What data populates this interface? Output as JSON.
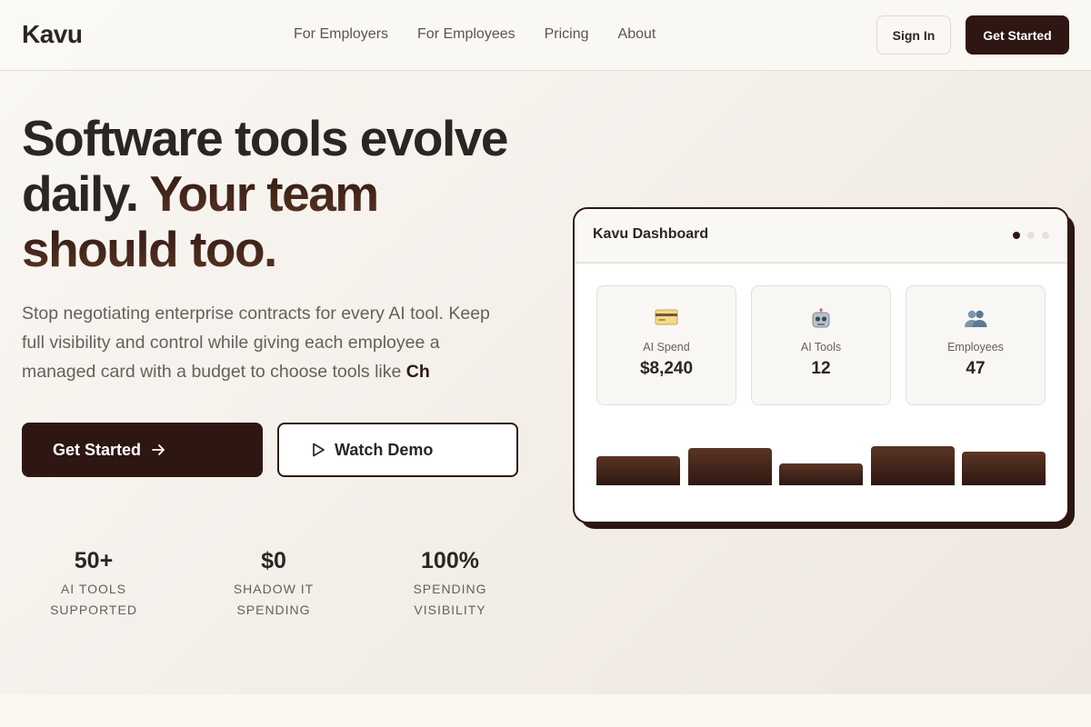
{
  "nav": {
    "logo": "Kavu",
    "links": [
      "For Employers",
      "For Employees",
      "Pricing",
      "About"
    ],
    "signin_label": "Sign In",
    "getstarted_label": "Get Started"
  },
  "hero": {
    "headline_part1": "Software tools evolve daily. ",
    "headline_part2": "Your team should too.",
    "subtext": "Stop negotiating enterprise contracts for every AI tool. Keep full visibility and control while giving each employee a managed card with a budget to choose tools like ",
    "typed_text": "Ch",
    "primary_cta": "Get Started",
    "secondary_cta": "Watch Demo"
  },
  "stats": [
    {
      "value": "50+",
      "label_line1": "AI TOOLS",
      "label_line2": "SUPPORTED"
    },
    {
      "value": "$0",
      "label_line1": "SHADOW IT",
      "label_line2": "SPENDING"
    },
    {
      "value": "100%",
      "label_line1": "SPENDING",
      "label_line2": "VISIBILITY"
    }
  ],
  "dashboard": {
    "title": "Kavu Dashboard",
    "active_dot": 0,
    "metrics": [
      {
        "icon": "credit-card-icon",
        "label": "AI Spend",
        "value": "$8,240"
      },
      {
        "icon": "robot-icon",
        "label": "AI Tools",
        "value": "12"
      },
      {
        "icon": "people-icon",
        "label": "Employees",
        "value": "47"
      }
    ],
    "bars": [
      0.74,
      0.95,
      0.55,
      1.0,
      0.86
    ]
  },
  "colors": {
    "brand_dark": "#2e1712",
    "accent_brown": "#5a3524",
    "background": "#faf7f2"
  }
}
